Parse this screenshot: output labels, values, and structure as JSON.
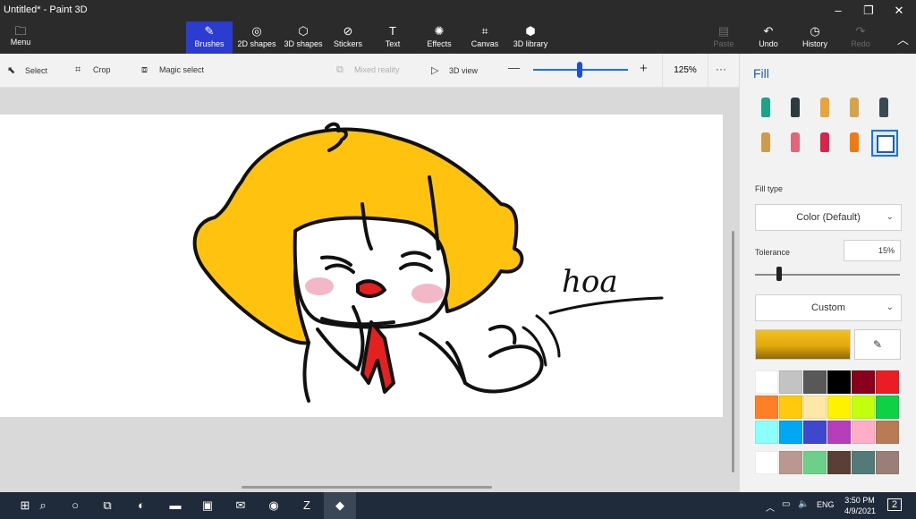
{
  "window": {
    "title": "Untitled* - Paint 3D",
    "minimize": "–",
    "maximize": "❐",
    "close": "✕"
  },
  "menu": {
    "label": "Menu",
    "icon": "folder-icon"
  },
  "tools": [
    {
      "label": "Brushes",
      "icon": "brush-icon",
      "glyph": "✎"
    },
    {
      "label": "2D shapes",
      "icon": "2d-shapes-icon",
      "glyph": "◎"
    },
    {
      "label": "3D shapes",
      "icon": "3d-shapes-icon",
      "glyph": "⬡"
    },
    {
      "label": "Stickers",
      "icon": "stickers-icon",
      "glyph": "⊘"
    },
    {
      "label": "Text",
      "icon": "text-icon",
      "glyph": "T"
    },
    {
      "label": "Effects",
      "icon": "effects-icon",
      "glyph": "✺"
    },
    {
      "label": "Canvas",
      "icon": "canvas-icon",
      "glyph": "⌗"
    },
    {
      "label": "3D library",
      "icon": "3d-library-icon",
      "glyph": "⬢"
    }
  ],
  "actions": [
    {
      "label": "Paste",
      "icon": "paste-icon",
      "glyph": "▤"
    },
    {
      "label": "Undo",
      "icon": "undo-icon",
      "glyph": "↶"
    },
    {
      "label": "History",
      "icon": "history-icon",
      "glyph": "◷"
    },
    {
      "label": "Redo",
      "icon": "redo-icon",
      "glyph": "↷"
    }
  ],
  "collapse_glyph": "︿",
  "toolbar2": {
    "select": "Select",
    "crop": "Crop",
    "magic_select": "Magic select",
    "mixed_reality": "Mixed reality",
    "view_3d": "3D view",
    "zoom_minus": "—",
    "zoom_plus": "+",
    "zoom_value": "125%",
    "more": "···"
  },
  "panel": {
    "title": "Fill",
    "fill_type_label": "Fill type",
    "fill_type_value": "Color (Default)",
    "tolerance_label": "Tolerance",
    "tolerance_value": "15%",
    "tolerance_fraction": 0.15,
    "custom_label": "Custom",
    "current_color": "#e8b20f",
    "brushes": [
      {
        "name": "marker",
        "color": "#1aa387"
      },
      {
        "name": "calligraphy-pen",
        "color": "#2d3a40"
      },
      {
        "name": "oil-brush",
        "color": "#e8a33a"
      },
      {
        "name": "watercolor",
        "color": "#d4a34a"
      },
      {
        "name": "pixel-pen",
        "color": "#3a4a55"
      },
      {
        "name": "pencil",
        "color": "#cf9a4a"
      },
      {
        "name": "eraser",
        "color": "#e2667a"
      },
      {
        "name": "crayon",
        "color": "#d9234a"
      },
      {
        "name": "spray-can",
        "color": "#f07a12"
      },
      {
        "name": "fill",
        "color": "#1a5fb4"
      }
    ],
    "swatches": [
      "#ffffff",
      "#c3c3c3",
      "#585858",
      "#000000",
      "#88001b",
      "#ec1c24",
      "#ff7f27",
      "#ffc90e",
      "#fde8a8",
      "#fff200",
      "#c4ff0e",
      "#0ed145",
      "#8cfffb",
      "#00a8f3",
      "#3f48cc",
      "#b83dba",
      "#ffaec8",
      "#b97a56",
      "#ffffff",
      "#b89890",
      "#6dcf8a",
      "#5a3f37",
      "#537a78",
      "#9a7f78"
    ]
  },
  "canvas": {
    "signature": "hoa"
  },
  "taskbar": {
    "items": [
      {
        "name": "start-icon",
        "glyph": "⊞"
      },
      {
        "name": "search-icon",
        "glyph": "⌕"
      },
      {
        "name": "cortana-icon",
        "glyph": "○"
      },
      {
        "name": "task-view-icon",
        "glyph": "⧉"
      },
      {
        "name": "edge-icon",
        "glyph": "◐"
      },
      {
        "name": "file-explorer-icon",
        "glyph": "▬"
      },
      {
        "name": "store-icon",
        "glyph": "▣"
      },
      {
        "name": "mail-icon",
        "glyph": "✉"
      },
      {
        "name": "chrome-icon",
        "glyph": "◉"
      },
      {
        "name": "zalo-icon",
        "glyph": "Z"
      },
      {
        "name": "paint3d-icon",
        "glyph": "◆"
      }
    ],
    "tray_chevron": "︿",
    "language": "ENG",
    "time": "3:50 PM",
    "date": "4/9/2021",
    "notifications": "2"
  }
}
